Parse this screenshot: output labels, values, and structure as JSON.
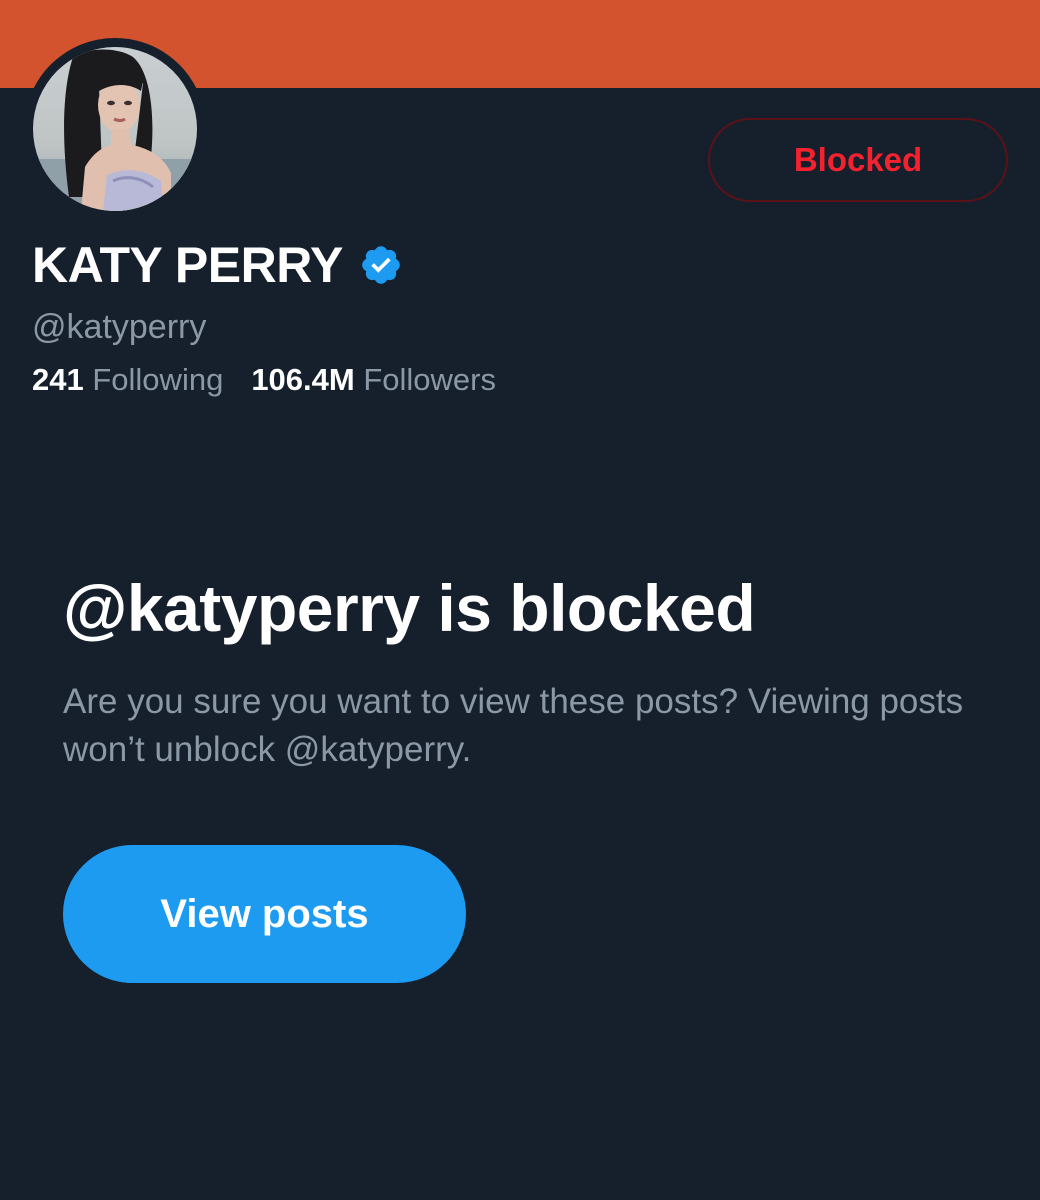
{
  "colors": {
    "background": "#16202c",
    "banner": "#d2532e",
    "accent_blue": "#1d9bf0",
    "blocked_red": "#f4212e",
    "secondary_text": "#8b98a5"
  },
  "profile": {
    "display_name": "KATY PERRY",
    "handle": "@katyperry",
    "verified": true,
    "verified_icon": "verified-badge-icon",
    "avatar": "profile-photo"
  },
  "actions": {
    "blocked_label": "Blocked"
  },
  "stats": {
    "following_count": "241",
    "following_label": "Following",
    "followers_count": "106.4M",
    "followers_label": "Followers"
  },
  "blocked_notice": {
    "title": "@katyperry is blocked",
    "message": "Are you sure you want to view these posts? Viewing posts won’t unblock @katyperry.",
    "button_label": "View posts"
  }
}
